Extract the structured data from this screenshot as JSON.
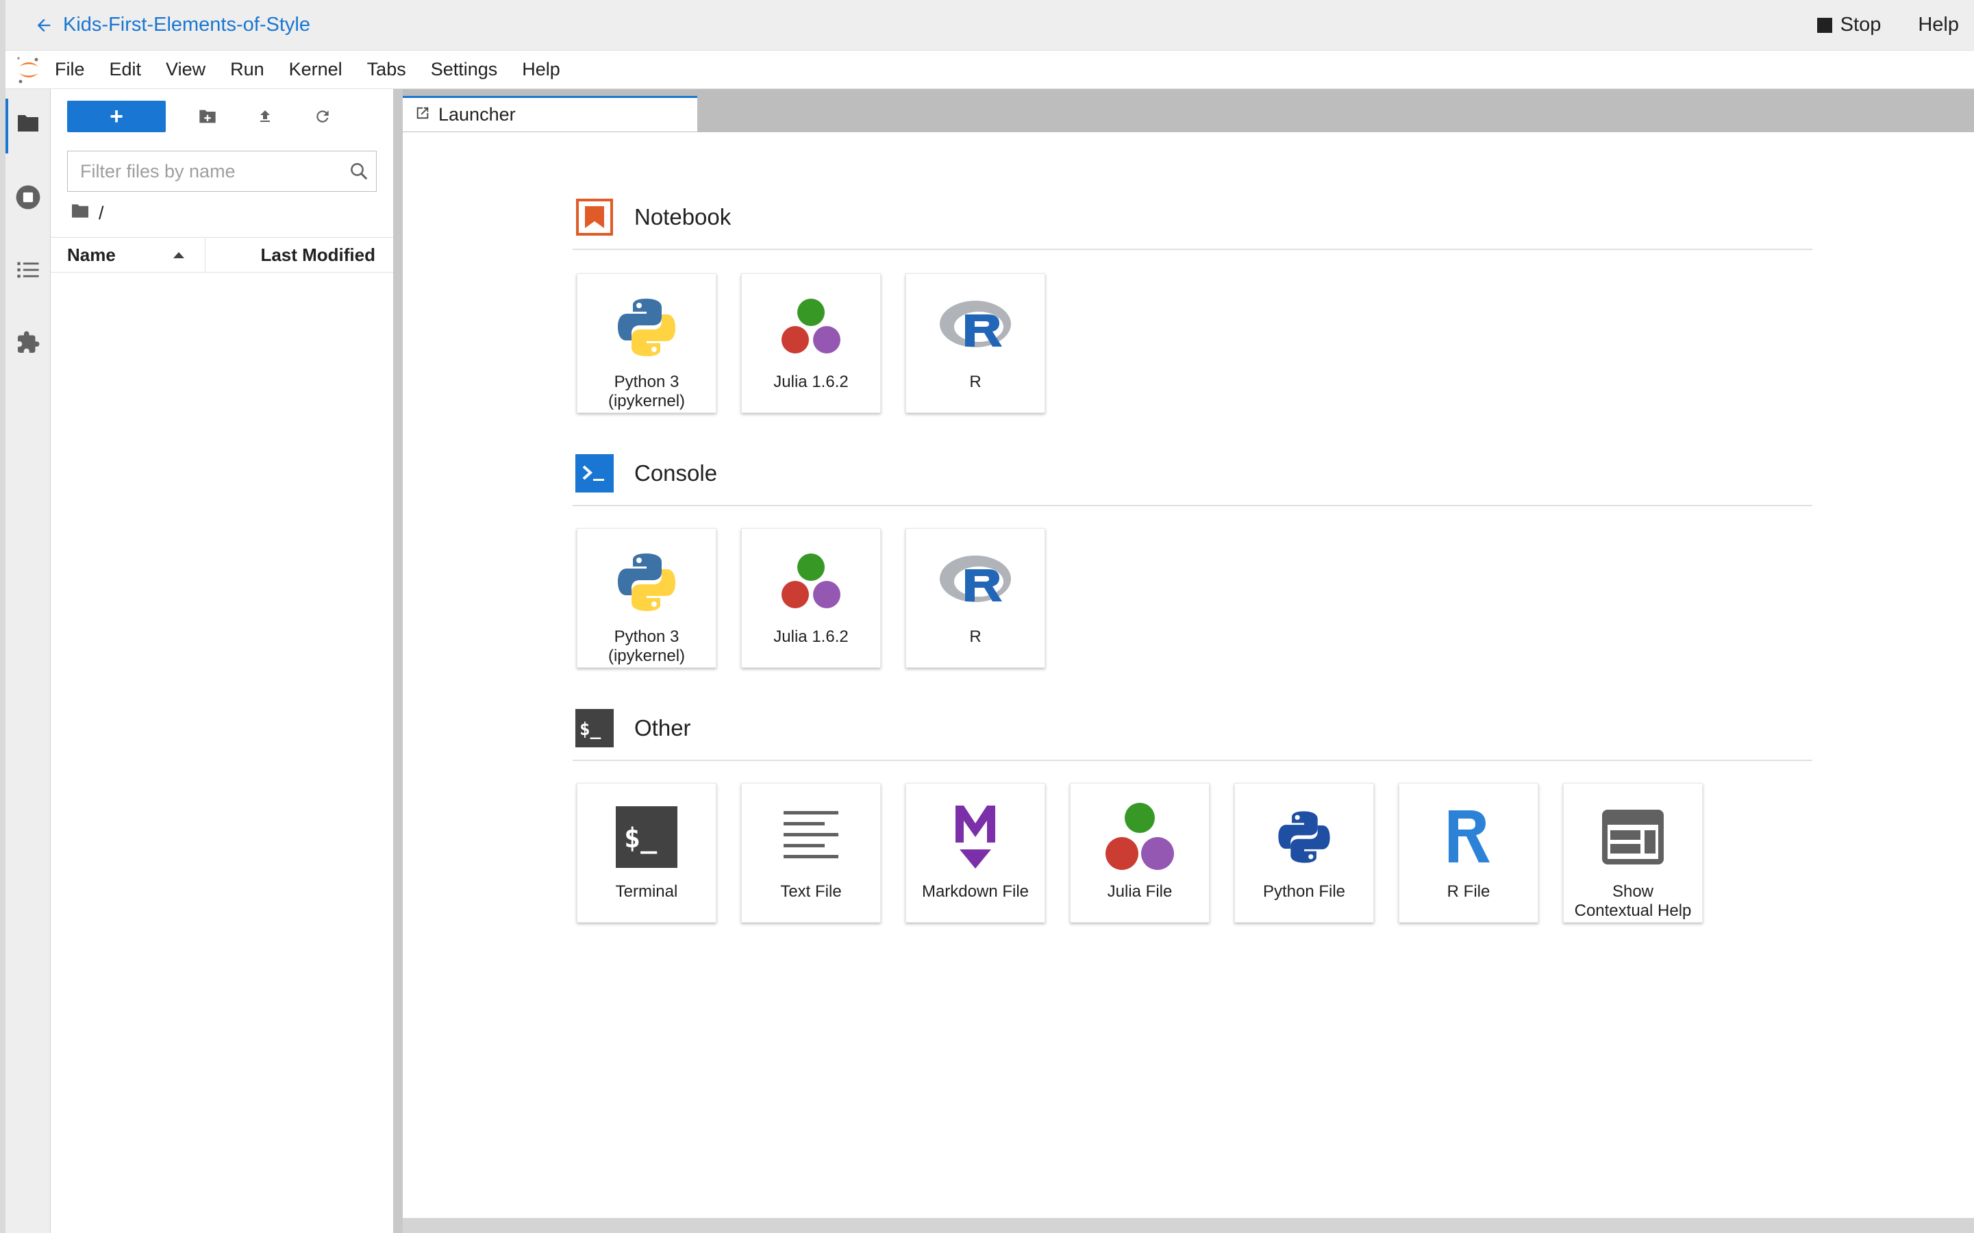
{
  "banner": {
    "title": "Kids-First-Elements-of-Style",
    "stop_label": "Stop",
    "help_label": "Help"
  },
  "menu": [
    "File",
    "Edit",
    "View",
    "Run",
    "Kernel",
    "Tabs",
    "Settings",
    "Help"
  ],
  "file_browser": {
    "new_label": "+",
    "filter_placeholder": "Filter files by name",
    "path": "/",
    "col_name": "Name",
    "col_modified": "Last Modified"
  },
  "tab": {
    "label": "Launcher"
  },
  "launcher": {
    "notebook": {
      "title": "Notebook",
      "items": [
        "Python 3\n(ipykernel)",
        "Julia 1.6.2",
        "R"
      ]
    },
    "console": {
      "title": "Console",
      "items": [
        "Python 3\n(ipykernel)",
        "Julia 1.6.2",
        "R"
      ]
    },
    "other": {
      "title": "Other",
      "items": [
        "Terminal",
        "Text File",
        "Markdown File",
        "Julia File",
        "Python File",
        "R File",
        "Show\nContextual Help"
      ]
    }
  },
  "colors": {
    "accent": "#1976d2",
    "notebook_icon": "#e05b27",
    "console_icon": "#1976d2",
    "other_icon": "#424242"
  }
}
